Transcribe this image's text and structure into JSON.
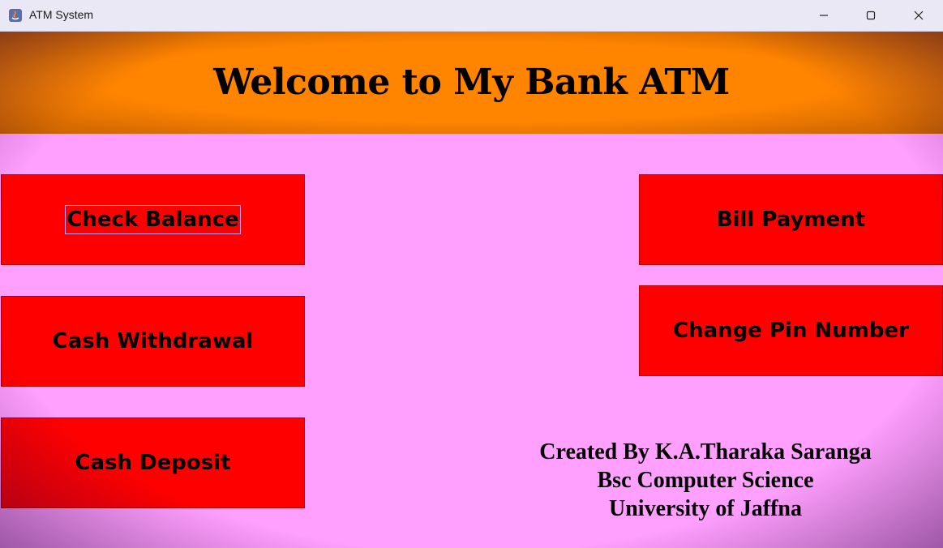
{
  "window": {
    "title": "ATM System",
    "controls": [
      "minimize-icon",
      "maximize-icon",
      "close-icon"
    ]
  },
  "header": {
    "title": "Welcome to My Bank ATM",
    "background_color": "#ff8400"
  },
  "body": {
    "background_color": "#ff9ffe"
  },
  "buttons": {
    "check_balance": "Check Balance",
    "cash_withdrawal": "Cash Withdrawal",
    "cash_deposit": "Cash Deposit",
    "bill_payment": "Bill Payment",
    "change_pin": "Change Pin Number",
    "color": "#ff0000"
  },
  "credits": {
    "line1": "Created By K.A.Tharaka Saranga",
    "line2": "Bsc Computer Science",
    "line3": "University of Jaffna"
  }
}
